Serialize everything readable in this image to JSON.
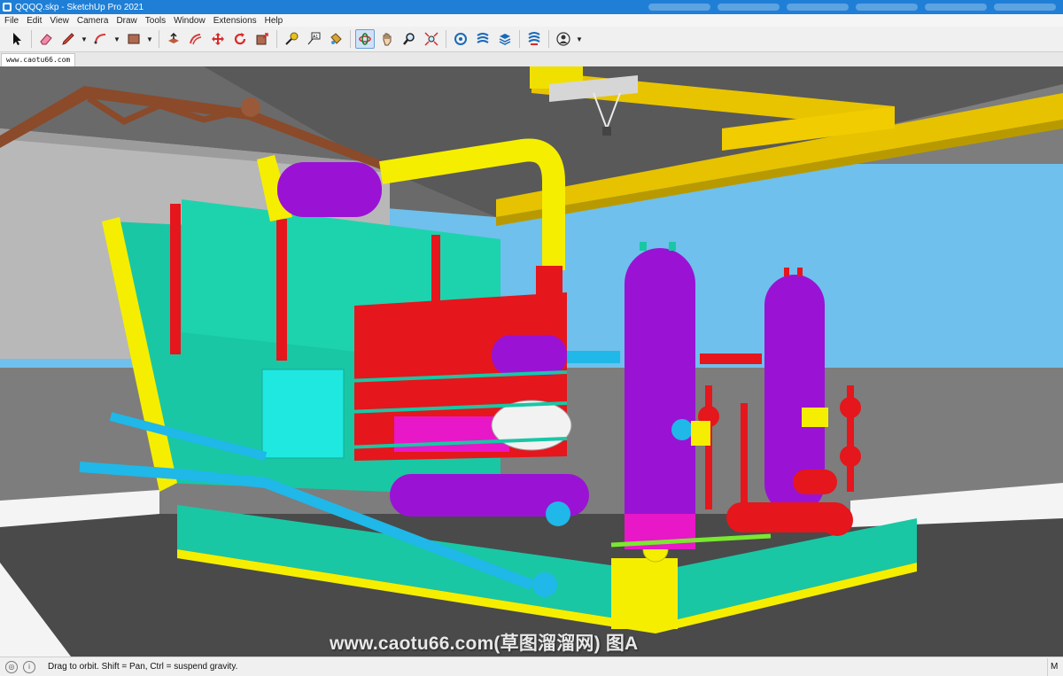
{
  "window": {
    "title": "QQQQ.skp - SketchUp Pro 2021"
  },
  "menubar": {
    "items": [
      "File",
      "Edit",
      "View",
      "Camera",
      "Draw",
      "Tools",
      "Window",
      "Extensions",
      "Help"
    ]
  },
  "toolbar": {
    "tools": [
      {
        "name": "select-tool",
        "icon": "arrow-cursor-icon"
      },
      {
        "name": "eraser-tool",
        "icon": "eraser-icon"
      },
      {
        "name": "line-tool",
        "icon": "pencil-icon",
        "dropdown": true
      },
      {
        "name": "arc-tool",
        "icon": "arc-icon",
        "dropdown": true
      },
      {
        "name": "rectangle-tool",
        "icon": "rectangle-icon",
        "dropdown": true
      },
      {
        "name": "push-pull-tool",
        "icon": "push-pull-icon"
      },
      {
        "name": "offset-tool",
        "icon": "offset-icon"
      },
      {
        "name": "move-tool",
        "icon": "move-icon"
      },
      {
        "name": "rotate-tool",
        "icon": "rotate-icon"
      },
      {
        "name": "scale-tool",
        "icon": "scale-icon"
      },
      {
        "name": "tape-measure-tool",
        "icon": "tape-measure-icon"
      },
      {
        "name": "text-tool",
        "icon": "text-icon"
      },
      {
        "name": "paint-bucket-tool",
        "icon": "paint-bucket-icon"
      },
      {
        "name": "orbit-tool",
        "icon": "orbit-icon",
        "active": true
      },
      {
        "name": "pan-tool",
        "icon": "hand-icon"
      },
      {
        "name": "zoom-tool",
        "icon": "magnifier-icon"
      },
      {
        "name": "zoom-extents-tool",
        "icon": "zoom-extents-icon"
      },
      {
        "name": "3d-warehouse-tool",
        "icon": "warehouse-icon"
      },
      {
        "name": "extension-warehouse-tool",
        "icon": "extension-warehouse-icon"
      },
      {
        "name": "layout-tool",
        "icon": "layers-icon"
      },
      {
        "name": "extension-manager-tool",
        "icon": "extension-manager-icon"
      },
      {
        "name": "account-tool",
        "icon": "user-icon",
        "dropdown": true
      }
    ]
  },
  "scene_tab": {
    "label": "www.caotu66.com"
  },
  "watermark": {
    "text": "www.caotu66.com(草图溜溜网) 图A"
  },
  "statusbar": {
    "hint": "Drag to orbit. Shift = Pan, Ctrl = suspend gravity.",
    "measurements_label": "M",
    "icons": [
      "geo-location-icon",
      "info-icon"
    ]
  },
  "colors": {
    "title_bar": "#1f7fd6",
    "skid": "#19c7a5",
    "tank": "#9a13d4",
    "pipe_yellow": "#f5ee00",
    "pipe_red": "#f20f0f",
    "pipe_blue": "#1fb8e8",
    "sky": "#6fc0ec"
  }
}
